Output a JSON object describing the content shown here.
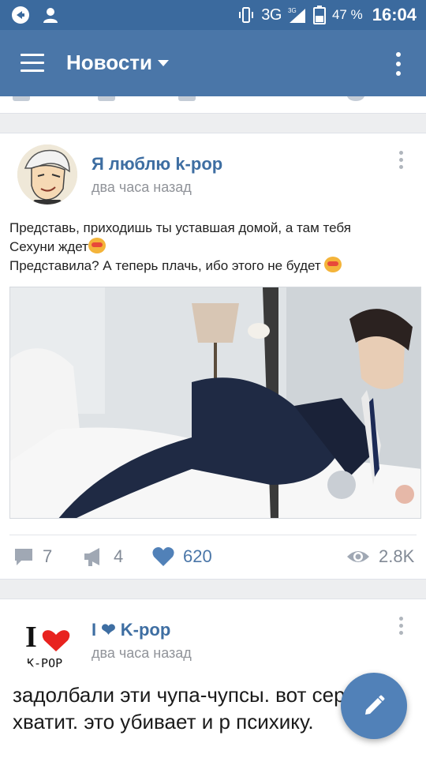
{
  "status_bar": {
    "network": "3G",
    "network_sup": "3G",
    "battery": "47 %",
    "time": "16:04"
  },
  "app_bar": {
    "title": "Новости"
  },
  "posts": [
    {
      "author": "Я люблю k-pop",
      "time": "два часа назад",
      "text_line1": "Представь, приходишь ты уставшая домой, а там тебя",
      "text_line2": "Сехуни ждет",
      "text_line3": "Представила? А теперь плачь, ибо этого не будет",
      "comments": "7",
      "reposts": "4",
      "likes": "620",
      "views": "2.8K"
    },
    {
      "author": "I ❤ K-pop",
      "time": "два часа назад",
      "avatar_caption": "K-POP",
      "avatar_mark": "I",
      "text": "задолбали эти чупа-чупсы. вот серьезно. хватит. это убивает и р психику."
    }
  ],
  "colors": {
    "status_bar": "#3b6a9e",
    "app_bar": "#4a76a8",
    "link": "#3e6ea2",
    "like": "#4a76a8",
    "fab": "#5181b8"
  },
  "icons": [
    "back-circle-icon",
    "person-icon",
    "vibrate-icon",
    "signal-icon",
    "battery-icon",
    "menu-icon",
    "caret-down-icon",
    "more-vertical-icon",
    "comment-icon",
    "repost-icon",
    "heart-icon",
    "eye-icon",
    "pencil-icon"
  ]
}
